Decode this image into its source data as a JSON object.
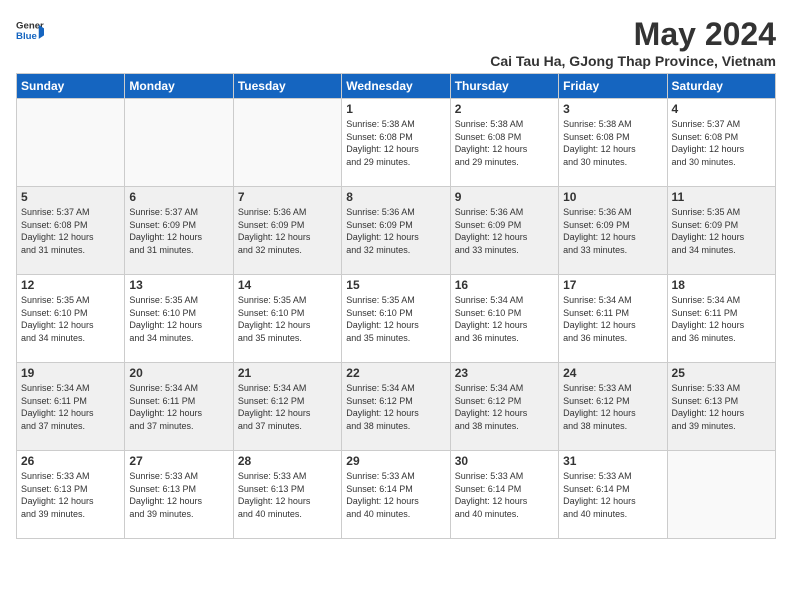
{
  "header": {
    "logo_general": "General",
    "logo_blue": "Blue",
    "month_title": "May 2024",
    "subtitle": "Cai Tau Ha, GJong Thap Province, Vietnam"
  },
  "days_of_week": [
    "Sunday",
    "Monday",
    "Tuesday",
    "Wednesday",
    "Thursday",
    "Friday",
    "Saturday"
  ],
  "weeks": [
    [
      {
        "day": "",
        "info": ""
      },
      {
        "day": "",
        "info": ""
      },
      {
        "day": "",
        "info": ""
      },
      {
        "day": "1",
        "info": "Sunrise: 5:38 AM\nSunset: 6:08 PM\nDaylight: 12 hours\nand 29 minutes."
      },
      {
        "day": "2",
        "info": "Sunrise: 5:38 AM\nSunset: 6:08 PM\nDaylight: 12 hours\nand 29 minutes."
      },
      {
        "day": "3",
        "info": "Sunrise: 5:38 AM\nSunset: 6:08 PM\nDaylight: 12 hours\nand 30 minutes."
      },
      {
        "day": "4",
        "info": "Sunrise: 5:37 AM\nSunset: 6:08 PM\nDaylight: 12 hours\nand 30 minutes."
      }
    ],
    [
      {
        "day": "5",
        "info": "Sunrise: 5:37 AM\nSunset: 6:08 PM\nDaylight: 12 hours\nand 31 minutes."
      },
      {
        "day": "6",
        "info": "Sunrise: 5:37 AM\nSunset: 6:09 PM\nDaylight: 12 hours\nand 31 minutes."
      },
      {
        "day": "7",
        "info": "Sunrise: 5:36 AM\nSunset: 6:09 PM\nDaylight: 12 hours\nand 32 minutes."
      },
      {
        "day": "8",
        "info": "Sunrise: 5:36 AM\nSunset: 6:09 PM\nDaylight: 12 hours\nand 32 minutes."
      },
      {
        "day": "9",
        "info": "Sunrise: 5:36 AM\nSunset: 6:09 PM\nDaylight: 12 hours\nand 33 minutes."
      },
      {
        "day": "10",
        "info": "Sunrise: 5:36 AM\nSunset: 6:09 PM\nDaylight: 12 hours\nand 33 minutes."
      },
      {
        "day": "11",
        "info": "Sunrise: 5:35 AM\nSunset: 6:09 PM\nDaylight: 12 hours\nand 34 minutes."
      }
    ],
    [
      {
        "day": "12",
        "info": "Sunrise: 5:35 AM\nSunset: 6:10 PM\nDaylight: 12 hours\nand 34 minutes."
      },
      {
        "day": "13",
        "info": "Sunrise: 5:35 AM\nSunset: 6:10 PM\nDaylight: 12 hours\nand 34 minutes."
      },
      {
        "day": "14",
        "info": "Sunrise: 5:35 AM\nSunset: 6:10 PM\nDaylight: 12 hours\nand 35 minutes."
      },
      {
        "day": "15",
        "info": "Sunrise: 5:35 AM\nSunset: 6:10 PM\nDaylight: 12 hours\nand 35 minutes."
      },
      {
        "day": "16",
        "info": "Sunrise: 5:34 AM\nSunset: 6:10 PM\nDaylight: 12 hours\nand 36 minutes."
      },
      {
        "day": "17",
        "info": "Sunrise: 5:34 AM\nSunset: 6:11 PM\nDaylight: 12 hours\nand 36 minutes."
      },
      {
        "day": "18",
        "info": "Sunrise: 5:34 AM\nSunset: 6:11 PM\nDaylight: 12 hours\nand 36 minutes."
      }
    ],
    [
      {
        "day": "19",
        "info": "Sunrise: 5:34 AM\nSunset: 6:11 PM\nDaylight: 12 hours\nand 37 minutes."
      },
      {
        "day": "20",
        "info": "Sunrise: 5:34 AM\nSunset: 6:11 PM\nDaylight: 12 hours\nand 37 minutes."
      },
      {
        "day": "21",
        "info": "Sunrise: 5:34 AM\nSunset: 6:12 PM\nDaylight: 12 hours\nand 37 minutes."
      },
      {
        "day": "22",
        "info": "Sunrise: 5:34 AM\nSunset: 6:12 PM\nDaylight: 12 hours\nand 38 minutes."
      },
      {
        "day": "23",
        "info": "Sunrise: 5:34 AM\nSunset: 6:12 PM\nDaylight: 12 hours\nand 38 minutes."
      },
      {
        "day": "24",
        "info": "Sunrise: 5:33 AM\nSunset: 6:12 PM\nDaylight: 12 hours\nand 38 minutes."
      },
      {
        "day": "25",
        "info": "Sunrise: 5:33 AM\nSunset: 6:13 PM\nDaylight: 12 hours\nand 39 minutes."
      }
    ],
    [
      {
        "day": "26",
        "info": "Sunrise: 5:33 AM\nSunset: 6:13 PM\nDaylight: 12 hours\nand 39 minutes."
      },
      {
        "day": "27",
        "info": "Sunrise: 5:33 AM\nSunset: 6:13 PM\nDaylight: 12 hours\nand 39 minutes."
      },
      {
        "day": "28",
        "info": "Sunrise: 5:33 AM\nSunset: 6:13 PM\nDaylight: 12 hours\nand 40 minutes."
      },
      {
        "day": "29",
        "info": "Sunrise: 5:33 AM\nSunset: 6:14 PM\nDaylight: 12 hours\nand 40 minutes."
      },
      {
        "day": "30",
        "info": "Sunrise: 5:33 AM\nSunset: 6:14 PM\nDaylight: 12 hours\nand 40 minutes."
      },
      {
        "day": "31",
        "info": "Sunrise: 5:33 AM\nSunset: 6:14 PM\nDaylight: 12 hours\nand 40 minutes."
      },
      {
        "day": "",
        "info": ""
      }
    ]
  ]
}
